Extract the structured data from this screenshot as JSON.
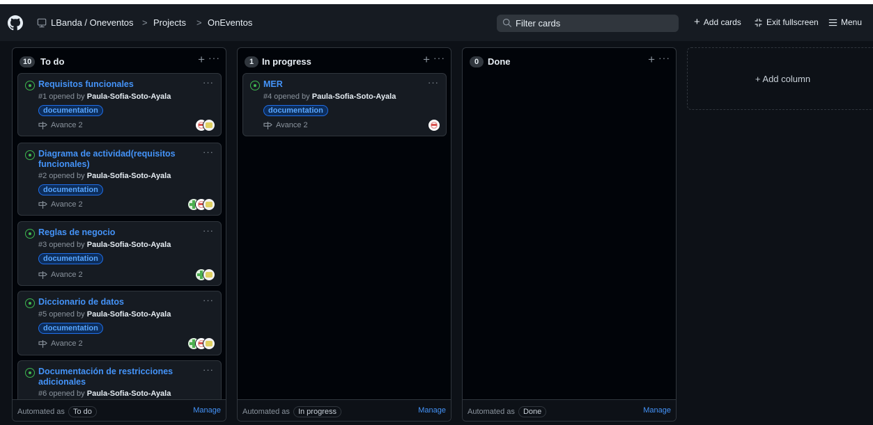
{
  "header": {
    "breadcrumb": [
      "LBanda / Oneventos",
      "Projects",
      "OnEventos"
    ],
    "filter_placeholder": "Filter cards",
    "add_cards": "Add cards",
    "exit_fullscreen": "Exit fullscreen",
    "menu": "Menu"
  },
  "columns": [
    {
      "count": "10",
      "title": "To do",
      "automated_label": "Automated as",
      "automated_value": "To do",
      "manage": "Manage",
      "cards": [
        {
          "title": "Requisitos funcionales",
          "meta_prefix": "#1 opened by",
          "author": "Paula-Sofia-Soto-Ayala",
          "label": "documentation",
          "milestone": "Avance 2"
        },
        {
          "title": "Diagrama de actividad(requisitos funcionales)",
          "meta_prefix": "#2 opened by",
          "author": "Paula-Sofia-Soto-Ayala",
          "label": "documentation",
          "milestone": "Avance 2"
        },
        {
          "title": "Reglas de negocio",
          "meta_prefix": "#3 opened by",
          "author": "Paula-Sofia-Soto-Ayala",
          "label": "documentation",
          "milestone": "Avance 2"
        },
        {
          "title": "Diccionario de datos",
          "meta_prefix": "#5 opened by",
          "author": "Paula-Sofia-Soto-Ayala",
          "label": "documentation",
          "milestone": "Avance 2"
        },
        {
          "title": "Documentación de restricciones adicionales",
          "meta_prefix": "#6 opened by",
          "author": "Paula-Sofia-Soto-Ayala"
        }
      ]
    },
    {
      "count": "1",
      "title": "In progress",
      "automated_label": "Automated as",
      "automated_value": "In progress",
      "manage": "Manage",
      "cards": [
        {
          "title": "MER",
          "meta_prefix": "#4 opened by",
          "author": "Paula-Sofia-Soto-Ayala",
          "label": "documentation",
          "milestone": "Avance 2"
        }
      ]
    },
    {
      "count": "0",
      "title": "Done",
      "automated_label": "Automated as",
      "automated_value": "Done",
      "manage": "Manage",
      "cards": []
    }
  ],
  "add_column": "+ Add column",
  "colors": {
    "accent_link": "#4493f8",
    "open_issue": "#3fb950",
    "background": "#0d1117"
  },
  "icons": [
    "github-logo-icon",
    "project-icon",
    "search-icon",
    "plus-icon",
    "collapse-icon",
    "hamburger-icon",
    "issue-opened-icon",
    "milestone-icon",
    "kebab-icon"
  ]
}
